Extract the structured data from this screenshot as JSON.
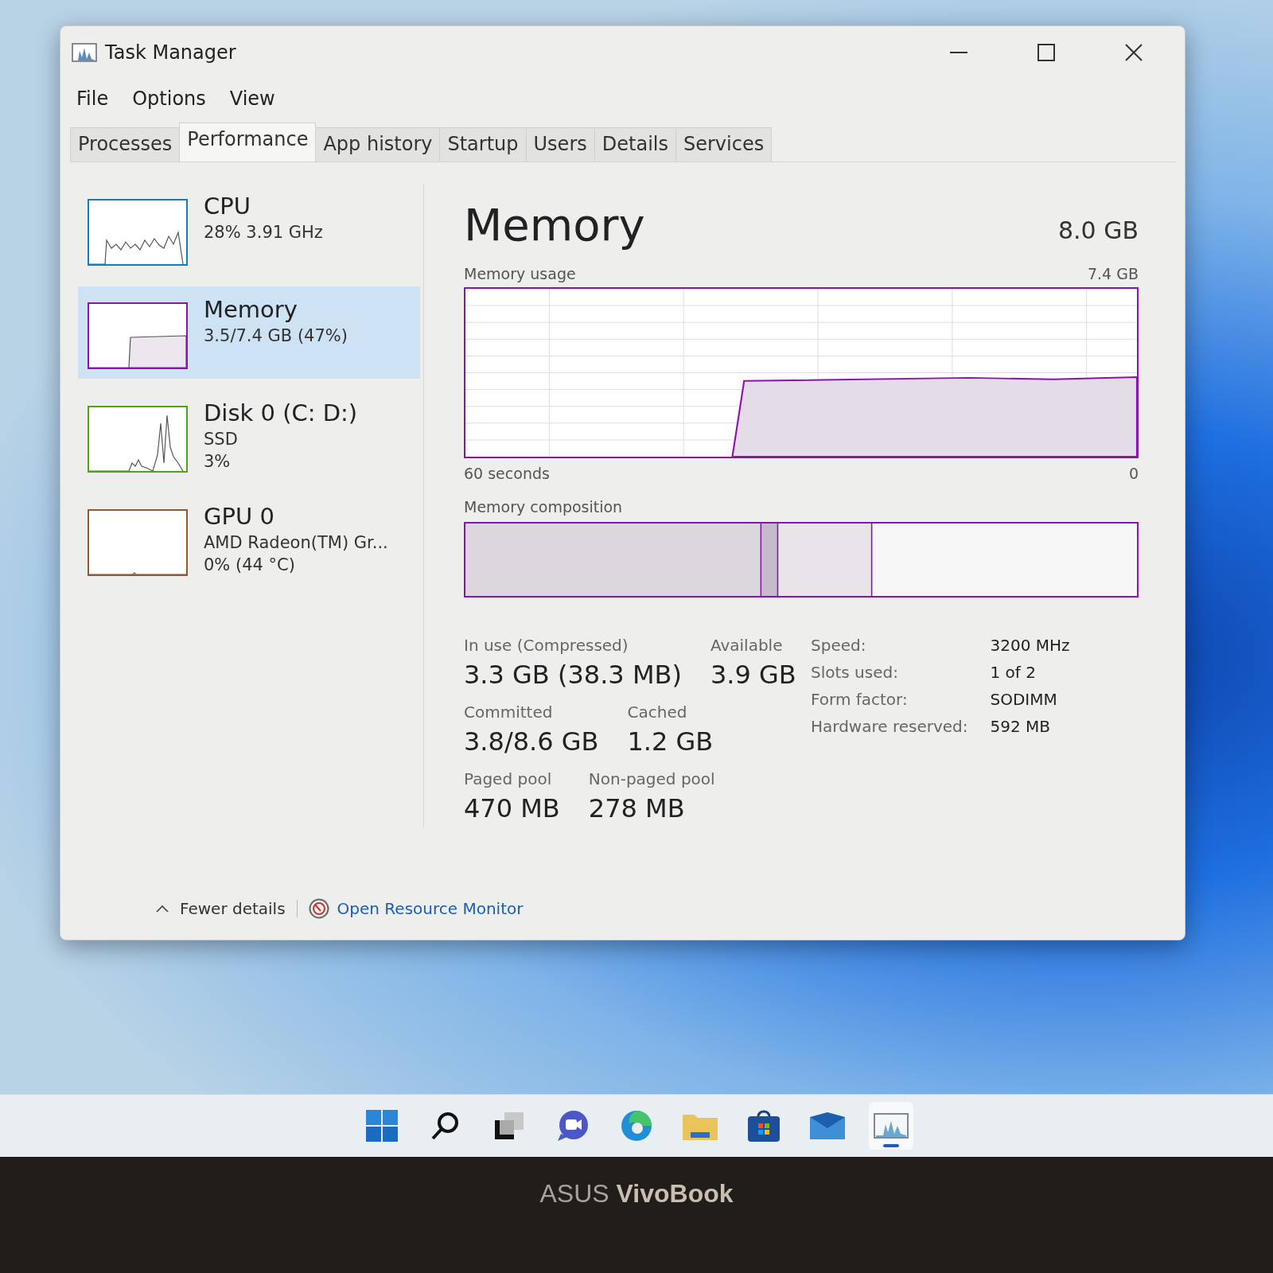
{
  "window": {
    "title": "Task Manager"
  },
  "menu": [
    "File",
    "Options",
    "View"
  ],
  "tabs": [
    {
      "label": "Processes",
      "selected": false
    },
    {
      "label": "Performance",
      "selected": true
    },
    {
      "label": "App history",
      "selected": false
    },
    {
      "label": "Startup",
      "selected": false
    },
    {
      "label": "Users",
      "selected": false
    },
    {
      "label": "Details",
      "selected": false
    },
    {
      "label": "Services",
      "selected": false
    }
  ],
  "sidebar": {
    "items": [
      {
        "kind": "cpu",
        "title": "CPU",
        "lines": [
          "28%  3.91 GHz"
        ],
        "color": "#117dbb",
        "selected": false
      },
      {
        "kind": "memory",
        "title": "Memory",
        "lines": [
          "3.5/7.4 GB (47%)"
        ],
        "color": "#8b12ae",
        "selected": true
      },
      {
        "kind": "disk",
        "title": "Disk 0 (C: D:)",
        "lines": [
          "SSD",
          "3%"
        ],
        "color": "#4da60c",
        "selected": false
      },
      {
        "kind": "gpu",
        "title": "GPU 0",
        "lines": [
          "AMD Radeon(TM) Gr...",
          "0%  (44 °C)"
        ],
        "color": "#8e5b2e",
        "selected": false
      }
    ]
  },
  "main": {
    "title": "Memory",
    "total": "8.0 GB",
    "usage": {
      "label": "Memory usage",
      "max": "7.4 GB",
      "time_span": "60 seconds",
      "min": "0"
    },
    "composition": {
      "label": "Memory composition"
    },
    "stats": [
      [
        {
          "label": "In use (Compressed)",
          "value": "3.3 GB (38.3 MB)"
        },
        {
          "label": "Available",
          "value": "3.9 GB"
        }
      ],
      [
        {
          "label": "Committed",
          "value": "3.8/8.6 GB"
        },
        {
          "label": "Cached",
          "value": "1.2 GB"
        }
      ],
      [
        {
          "label": "Paged pool",
          "value": "470 MB"
        },
        {
          "label": "Non-paged pool",
          "value": "278 MB"
        }
      ]
    ],
    "hardware": [
      {
        "label": "Speed:",
        "value": "3200 MHz"
      },
      {
        "label": "Slots used:",
        "value": "1 of 2"
      },
      {
        "label": "Form factor:",
        "value": "SODIMM"
      },
      {
        "label": "Hardware reserved:",
        "value": "592 MB"
      }
    ]
  },
  "footer": {
    "fewer_details": "Fewer details",
    "resource_monitor": "Open Resource Monitor"
  },
  "taskbar": {
    "items": [
      {
        "kind": "start",
        "running": false
      },
      {
        "kind": "search",
        "running": false
      },
      {
        "kind": "task-view",
        "running": false
      },
      {
        "kind": "chat",
        "running": false
      },
      {
        "kind": "browser",
        "running": false
      },
      {
        "kind": "explorer",
        "running": false
      },
      {
        "kind": "store",
        "running": false
      },
      {
        "kind": "mail",
        "running": false
      },
      {
        "kind": "task-manager",
        "running": true
      }
    ]
  },
  "bezel": {
    "logo": "ASUS **VivoBook**"
  }
}
